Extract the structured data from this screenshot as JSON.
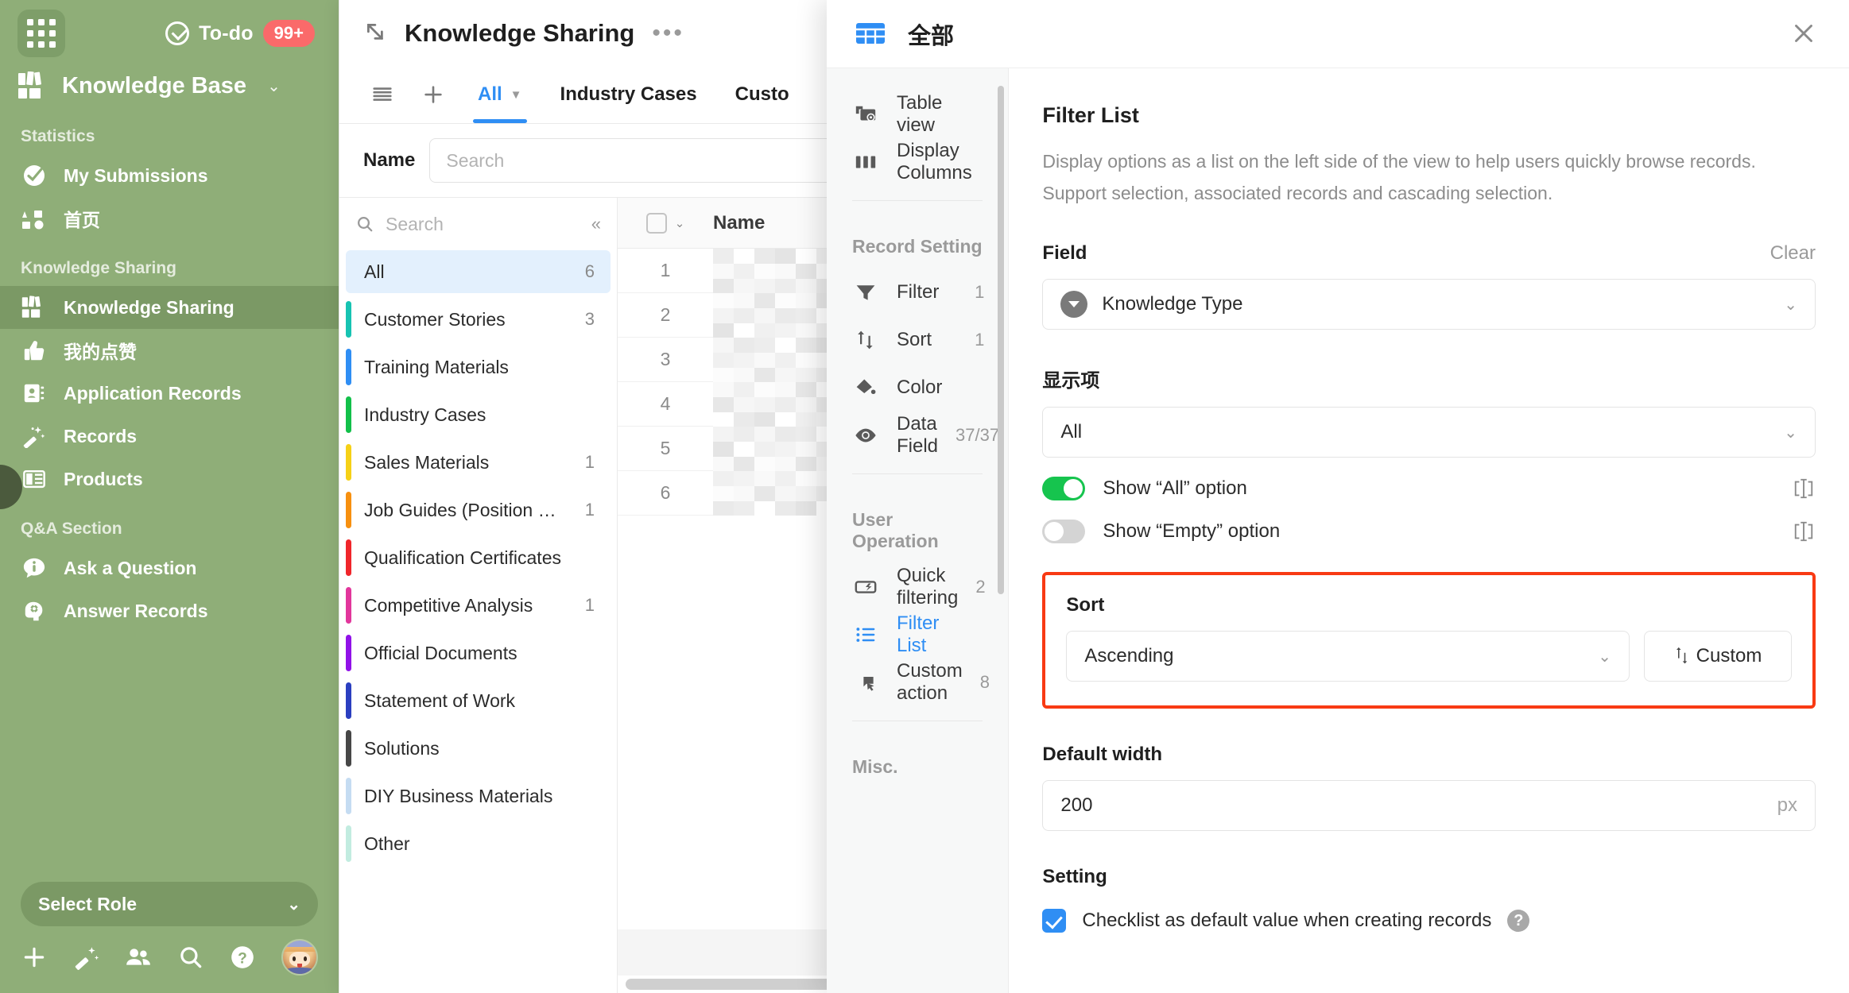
{
  "sidebar": {
    "todo_label": "To-do",
    "todo_badge": "99+",
    "workspace_title": "Knowledge Base",
    "sections": [
      {
        "title": "Statistics",
        "items": [
          {
            "label": "My Submissions",
            "icon": "check-circle-icon"
          },
          {
            "label": "首页",
            "icon": "shapes-icon"
          }
        ]
      },
      {
        "title": "Knowledge Sharing",
        "items": [
          {
            "label": "Knowledge Sharing",
            "icon": "books-icon",
            "active": true
          },
          {
            "label": "我的点赞",
            "icon": "thumbs-up-icon"
          },
          {
            "label": "Application Records",
            "icon": "contact-card-icon"
          },
          {
            "label": "Records",
            "icon": "magic-wand-icon"
          },
          {
            "label": "Products",
            "icon": "layout-icon"
          }
        ]
      },
      {
        "title": "Q&A Section",
        "items": [
          {
            "label": "Ask a Question",
            "icon": "info-bubble-icon"
          },
          {
            "label": "Answer Records",
            "icon": "brain-head-icon"
          }
        ]
      }
    ],
    "role_select_label": "Select Role",
    "bottom_icons": [
      "plus-icon",
      "magic-icon",
      "people-icon",
      "search-icon",
      "help-icon",
      "avatar"
    ]
  },
  "record_panel": {
    "title": "Knowledge Sharing",
    "more_dots": "•••",
    "tabs": [
      {
        "label": "All",
        "active": true,
        "has_caret": true
      },
      {
        "label": "Industry Cases",
        "active": false
      },
      {
        "label": "Custo",
        "active": false
      }
    ],
    "search": {
      "field_label": "Name",
      "placeholder": "Search"
    },
    "filter_list": {
      "search_placeholder": "Search",
      "items": [
        {
          "label": "All",
          "count": "6",
          "color": "",
          "selected": true
        },
        {
          "label": "Customer Stories",
          "count": "3",
          "color": "#17c3b2"
        },
        {
          "label": "Training Materials",
          "count": "",
          "color": "#2f8ef4"
        },
        {
          "label": "Industry Cases",
          "count": "",
          "color": "#12c04a"
        },
        {
          "label": "Sales Materials",
          "count": "1",
          "color": "#f6d117"
        },
        {
          "label": "Job Guides (Position …",
          "count": "1",
          "color": "#f79010"
        },
        {
          "label": "Qualification Certificates",
          "count": "",
          "color": "#f0262b"
        },
        {
          "label": "Competitive Analysis",
          "count": "1",
          "color": "#e2369c"
        },
        {
          "label": "Official Documents",
          "count": "",
          "color": "#9112e8"
        },
        {
          "label": "Statement of Work",
          "count": "",
          "color": "#2b3fc0"
        },
        {
          "label": "Solutions",
          "count": "",
          "color": "#474747"
        },
        {
          "label": "DIY Business Materials",
          "count": "",
          "color": "#c5dcf2"
        },
        {
          "label": "Other",
          "count": "",
          "color": "#c2ece0"
        }
      ]
    },
    "table": {
      "columns": [
        "Name"
      ],
      "rows": [
        "1",
        "2",
        "3",
        "4",
        "5",
        "6"
      ]
    }
  },
  "drawer": {
    "header_title": "全部",
    "menu": [
      {
        "label": "Table view",
        "icon": "table-view-icon",
        "count": ""
      },
      {
        "label": "Display Columns",
        "icon": "columns-icon",
        "count": ""
      }
    ],
    "section_record": "Record Setting",
    "menu_record": [
      {
        "label": "Filter",
        "icon": "funnel-icon",
        "count": "1"
      },
      {
        "label": "Sort",
        "icon": "sort-arrows-icon",
        "count": "1"
      },
      {
        "label": "Color",
        "icon": "paint-bucket-icon",
        "count": ""
      },
      {
        "label": "Data Field",
        "icon": "eye-icon",
        "count": "37/37"
      }
    ],
    "section_user": "User Operation",
    "menu_user": [
      {
        "label": "Quick filtering",
        "icon": "quick-filter-icon",
        "count": "2"
      },
      {
        "label": "Filter List",
        "icon": "list-icon",
        "count": "",
        "active": true
      },
      {
        "label": "Custom action",
        "icon": "cursor-box-icon",
        "count": "8"
      }
    ],
    "section_misc": "Misc.",
    "content": {
      "title": "Filter List",
      "description": "Display options as a list on the left side of the view to help users quickly browse records. Support selection, associated records and cascading selection.",
      "field_label": "Field",
      "clear_label": "Clear",
      "field_value": "Knowledge Type",
      "display_items_label": "显示项",
      "display_items_value": "All",
      "toggle_all_label": "Show “All” option",
      "toggle_all_on": true,
      "toggle_empty_label": "Show “Empty” option",
      "toggle_empty_on": false,
      "sort_label": "Sort",
      "sort_value": "Ascending",
      "custom_label": "Custom",
      "default_width_label": "Default width",
      "default_width_value": "200",
      "default_width_unit": "px",
      "setting_label": "Setting",
      "checklist_label": "Checklist as default value when creating records",
      "checklist_checked": true,
      "highlight_color": "#f83a13"
    }
  }
}
